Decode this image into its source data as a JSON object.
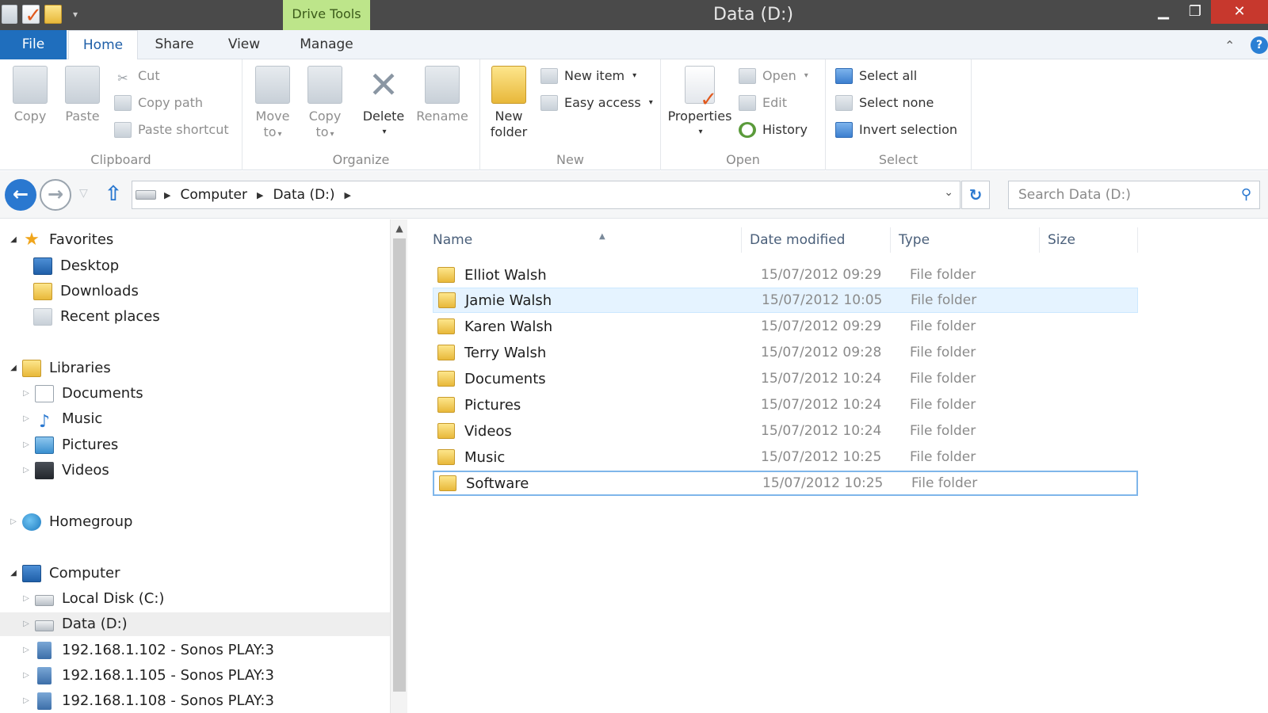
{
  "window": {
    "title": "Data (D:)",
    "context_tab": "Drive Tools",
    "buttons": {
      "minimize": "▁",
      "maximize": "❐",
      "close": "✕"
    }
  },
  "tabs": {
    "file": "File",
    "home": "Home",
    "share": "Share",
    "view": "View",
    "manage": "Manage"
  },
  "ribbon": {
    "clipboard": {
      "label": "Clipboard",
      "copy": "Copy",
      "paste": "Paste",
      "cut": "Cut",
      "copy_path": "Copy path",
      "paste_shortcut": "Paste shortcut"
    },
    "organize": {
      "label": "Organize",
      "move_to_1": "Move",
      "move_to_2": "to",
      "copy_to_1": "Copy",
      "copy_to_2": "to",
      "delete": "Delete",
      "rename": "Rename"
    },
    "new": {
      "label": "New",
      "new_folder_1": "New",
      "new_folder_2": "folder",
      "new_item": "New item",
      "easy_access": "Easy access"
    },
    "open": {
      "label": "Open",
      "properties": "Properties",
      "open": "Open",
      "edit": "Edit",
      "history": "History"
    },
    "select": {
      "label": "Select",
      "select_all": "Select all",
      "select_none": "Select none",
      "invert_selection": "Invert selection"
    }
  },
  "address": {
    "crumbs": [
      "Computer",
      "Data (D:)"
    ],
    "search_placeholder": "Search Data (D:)"
  },
  "nav": {
    "favorites": "Favorites",
    "desktop": "Desktop",
    "downloads": "Downloads",
    "recent_places": "Recent places",
    "libraries": "Libraries",
    "documents": "Documents",
    "music": "Music",
    "pictures": "Pictures",
    "videos": "Videos",
    "homegroup": "Homegroup",
    "computer": "Computer",
    "local_disk": "Local Disk (C:)",
    "data_d": "Data (D:)",
    "sonos_1": "192.168.1.102 - Sonos PLAY:3",
    "sonos_2": "192.168.1.105 - Sonos PLAY:3",
    "sonos_3": "192.168.1.108 - Sonos PLAY:3"
  },
  "columns": {
    "name": "Name",
    "date": "Date modified",
    "type": "Type",
    "size": "Size"
  },
  "files": [
    {
      "name": "Elliot Walsh",
      "date": "15/07/2012 09:29",
      "type": "File folder"
    },
    {
      "name": "Jamie Walsh",
      "date": "15/07/2012 10:05",
      "type": "File folder"
    },
    {
      "name": "Karen Walsh",
      "date": "15/07/2012 09:29",
      "type": "File folder"
    },
    {
      "name": "Terry Walsh",
      "date": "15/07/2012 09:28",
      "type": "File folder"
    },
    {
      "name": "Documents",
      "date": "15/07/2012 10:24",
      "type": "File folder"
    },
    {
      "name": "Pictures",
      "date": "15/07/2012 10:24",
      "type": "File folder"
    },
    {
      "name": "Videos",
      "date": "15/07/2012 10:24",
      "type": "File folder"
    },
    {
      "name": "Music",
      "date": "15/07/2012 10:25",
      "type": "File folder"
    },
    {
      "name": "Software",
      "date": "15/07/2012 10:25",
      "type": "File folder"
    }
  ]
}
